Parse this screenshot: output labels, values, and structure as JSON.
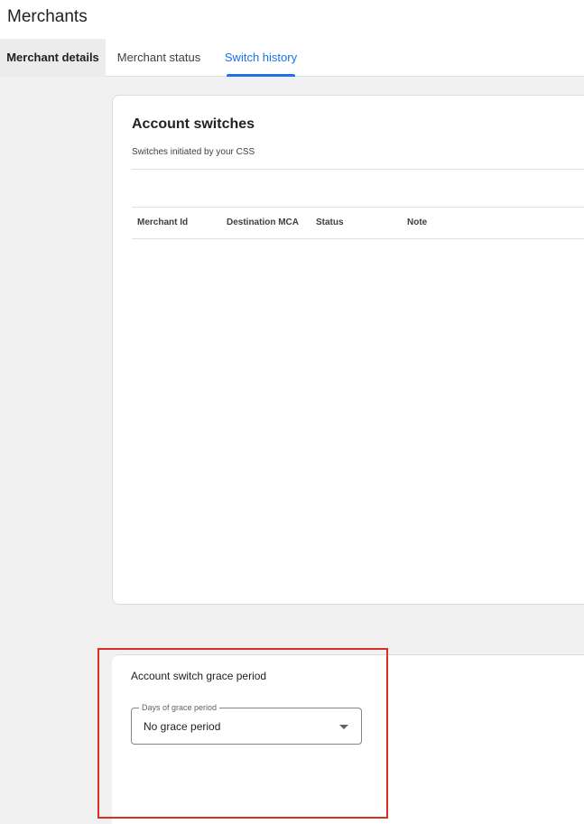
{
  "page": {
    "title": "Merchants"
  },
  "tabs": [
    {
      "label": "Merchant details",
      "state": "default"
    },
    {
      "label": "Merchant status",
      "state": "default"
    },
    {
      "label": "Switch history",
      "state": "selected"
    }
  ],
  "switches": {
    "title": "Account switches",
    "subtitle": "Switches initiated by your CSS",
    "columns": [
      "Merchant Id",
      "Destination MCA",
      "Status",
      "Note"
    ],
    "rows": []
  },
  "grace_period": {
    "title": "Account switch grace period",
    "field_label": "Days of grace period",
    "selected_value": "No grace period",
    "icon": "dropdown-arrow-icon"
  },
  "colors": {
    "accent": "#1a73e8",
    "highlight": "#d93025",
    "background": "#f1f1f1"
  }
}
